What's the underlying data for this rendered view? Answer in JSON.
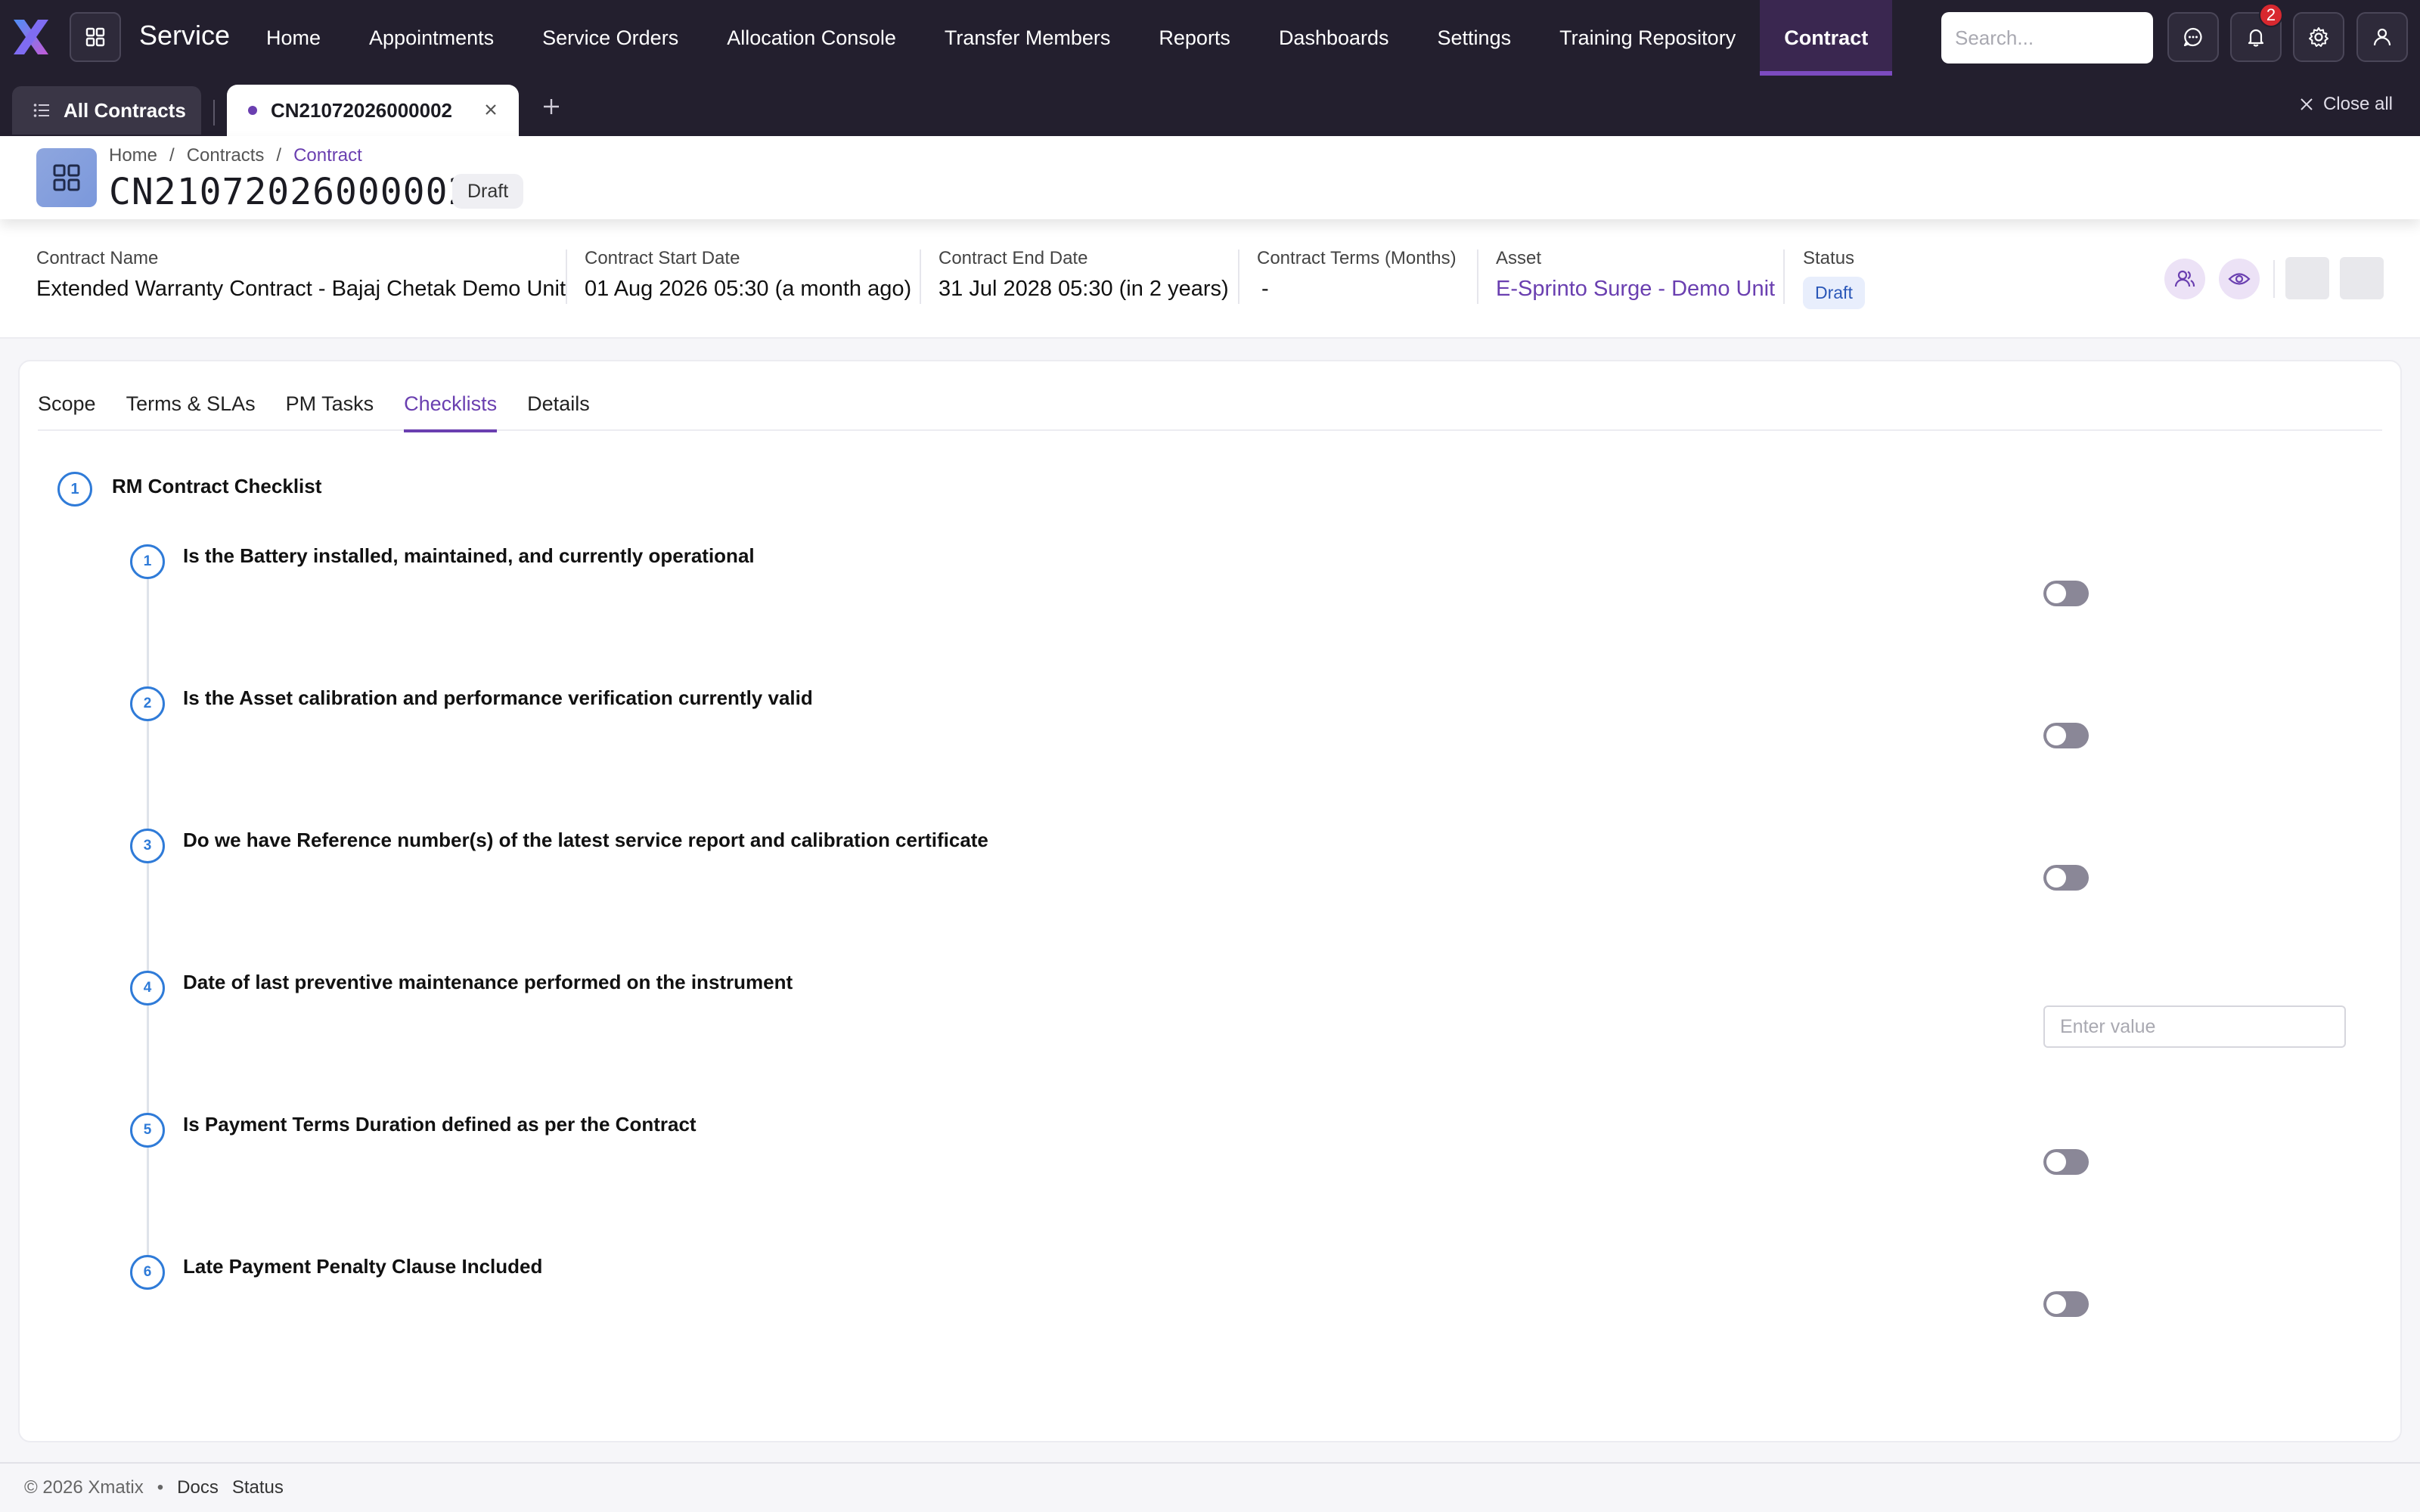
{
  "app": {
    "title": "Service"
  },
  "nav": {
    "items": [
      {
        "label": "Home",
        "active": false
      },
      {
        "label": "Appointments",
        "active": false
      },
      {
        "label": "Service Orders",
        "active": false
      },
      {
        "label": "Allocation Console",
        "active": false
      },
      {
        "label": "Transfer Members",
        "active": false
      },
      {
        "label": "Reports",
        "active": false
      },
      {
        "label": "Dashboards",
        "active": false
      },
      {
        "label": "Settings",
        "active": false
      },
      {
        "label": "Training Repository",
        "active": false
      },
      {
        "label": "Contract",
        "active": true
      }
    ]
  },
  "search": {
    "placeholder": "Search..."
  },
  "notifications": {
    "count": "2"
  },
  "tabs_bar": {
    "all_label": "All Contracts",
    "doc_tab_label": "CN21072026000002",
    "close_all_label": "Close all"
  },
  "breadcrumb": {
    "home": "Home",
    "sep": "/",
    "contracts": "Contracts",
    "current": "Contract"
  },
  "page": {
    "title": "CN21072026000002",
    "status": "Draft"
  },
  "summary": {
    "contract_name_label": "Contract Name",
    "contract_name": "Extended Warranty Contract - Bajaj Chetak Demo Unit",
    "start_date_label": "Contract Start Date",
    "start_date": "01 Aug 2026 05:30 (a month ago)",
    "end_date_label": "Contract End Date",
    "end_date": "31 Jul 2028 05:30 (in 2 years)",
    "terms_label": "Contract Terms (Months)",
    "terms": "-",
    "asset_label": "Asset",
    "asset": "E-Sprinto Surge - Demo Unit",
    "status_label": "Status",
    "status": "Draft"
  },
  "content_tabs": [
    {
      "label": "Scope",
      "active": false
    },
    {
      "label": "Terms & SLAs",
      "active": false
    },
    {
      "label": "PM Tasks",
      "active": false
    },
    {
      "label": "Checklists",
      "active": true
    },
    {
      "label": "Details",
      "active": false
    }
  ],
  "checklist": {
    "number": "1",
    "title": "RM Contract Checklist",
    "questions": [
      {
        "number": "1",
        "text": "Is the Battery installed, maintained, and currently operational",
        "type": "toggle",
        "value": false
      },
      {
        "number": "2",
        "text": "Is the Asset calibration and performance verification currently valid",
        "type": "toggle",
        "value": false
      },
      {
        "number": "3",
        "text": "Do we have Reference number(s) of the latest service report and calibration certificate",
        "type": "toggle",
        "value": false
      },
      {
        "number": "4",
        "text": "Date of last preventive maintenance performed on the instrument",
        "type": "input",
        "placeholder": "Enter value",
        "value": ""
      },
      {
        "number": "5",
        "text": "Is Payment Terms Duration defined as per the Contract",
        "type": "toggle",
        "value": false
      },
      {
        "number": "6",
        "text": "Late Payment Penalty Clause Included",
        "type": "toggle",
        "value": false
      }
    ]
  },
  "footer": {
    "copyright": "© 2026 Xmatix",
    "dot": "•",
    "docs": "Docs",
    "status": "Status"
  },
  "colors": {
    "accent": "#6a3fb0",
    "nav_bg": "#231f2e",
    "step_blue": "#2f7bd8",
    "toggle_off": "#8a8797"
  },
  "icons": [
    "x-logo-icon",
    "app-grid-icon",
    "search-icon",
    "chat-icon",
    "bell-icon",
    "gear-icon",
    "user-icon",
    "list-icon",
    "close-icon",
    "plus-icon",
    "grid-icon",
    "people-icon",
    "eye-icon"
  ]
}
